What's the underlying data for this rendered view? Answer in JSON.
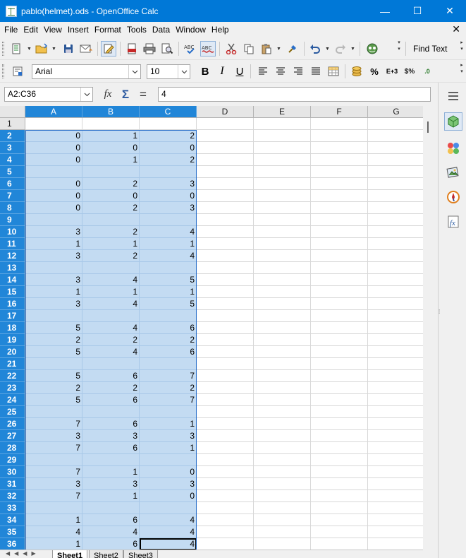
{
  "window": {
    "title": "pablo(helmet).ods - OpenOffice Calc",
    "minimize": "—",
    "maximize": "☐",
    "close": "✕"
  },
  "menu": [
    "File",
    "Edit",
    "View",
    "Insert",
    "Format",
    "Tools",
    "Data",
    "Window",
    "Help"
  ],
  "menu_close_doc": "✕",
  "toolbar": {
    "find_text": "Find Text"
  },
  "format_toolbar": {
    "font_name": "Arial",
    "font_size": "10",
    "bold": "B",
    "italic": "I",
    "underline": "U",
    "percent": "%",
    "scientific": "E+3",
    "currency": "$%",
    "add_decimal": ".0",
    "fx": "fx",
    "sum": "Σ",
    "equals": "="
  },
  "formula_bar": {
    "name_box": "A2:C36",
    "content": "4"
  },
  "columns": [
    "A",
    "B",
    "C",
    "D",
    "E",
    "F",
    "G"
  ],
  "selected_columns": [
    "A",
    "B",
    "C"
  ],
  "rows": [
    {
      "n": "1",
      "a": "",
      "b": "",
      "c": ""
    },
    {
      "n": "2",
      "a": "0",
      "b": "1",
      "c": "2"
    },
    {
      "n": "3",
      "a": "0",
      "b": "0",
      "c": "0"
    },
    {
      "n": "4",
      "a": "0",
      "b": "1",
      "c": "2"
    },
    {
      "n": "5",
      "a": "",
      "b": "",
      "c": ""
    },
    {
      "n": "6",
      "a": "0",
      "b": "2",
      "c": "3"
    },
    {
      "n": "7",
      "a": "0",
      "b": "0",
      "c": "0"
    },
    {
      "n": "8",
      "a": "0",
      "b": "2",
      "c": "3"
    },
    {
      "n": "9",
      "a": "",
      "b": "",
      "c": ""
    },
    {
      "n": "10",
      "a": "3",
      "b": "2",
      "c": "4"
    },
    {
      "n": "11",
      "a": "1",
      "b": "1",
      "c": "1"
    },
    {
      "n": "12",
      "a": "3",
      "b": "2",
      "c": "4"
    },
    {
      "n": "13",
      "a": "",
      "b": "",
      "c": ""
    },
    {
      "n": "14",
      "a": "3",
      "b": "4",
      "c": "5"
    },
    {
      "n": "15",
      "a": "1",
      "b": "1",
      "c": "1"
    },
    {
      "n": "16",
      "a": "3",
      "b": "4",
      "c": "5"
    },
    {
      "n": "17",
      "a": "",
      "b": "",
      "c": ""
    },
    {
      "n": "18",
      "a": "5",
      "b": "4",
      "c": "6"
    },
    {
      "n": "19",
      "a": "2",
      "b": "2",
      "c": "2"
    },
    {
      "n": "20",
      "a": "5",
      "b": "4",
      "c": "6"
    },
    {
      "n": "21",
      "a": "",
      "b": "",
      "c": ""
    },
    {
      "n": "22",
      "a": "5",
      "b": "6",
      "c": "7"
    },
    {
      "n": "23",
      "a": "2",
      "b": "2",
      "c": "2"
    },
    {
      "n": "24",
      "a": "5",
      "b": "6",
      "c": "7"
    },
    {
      "n": "25",
      "a": "",
      "b": "",
      "c": ""
    },
    {
      "n": "26",
      "a": "7",
      "b": "6",
      "c": "1"
    },
    {
      "n": "27",
      "a": "3",
      "b": "3",
      "c": "3"
    },
    {
      "n": "28",
      "a": "7",
      "b": "6",
      "c": "1"
    },
    {
      "n": "29",
      "a": "",
      "b": "",
      "c": ""
    },
    {
      "n": "30",
      "a": "7",
      "b": "1",
      "c": "0"
    },
    {
      "n": "31",
      "a": "3",
      "b": "3",
      "c": "3"
    },
    {
      "n": "32",
      "a": "7",
      "b": "1",
      "c": "0"
    },
    {
      "n": "33",
      "a": "",
      "b": "",
      "c": ""
    },
    {
      "n": "34",
      "a": "1",
      "b": "6",
      "c": "4"
    },
    {
      "n": "35",
      "a": "4",
      "b": "4",
      "c": "4"
    },
    {
      "n": "36",
      "a": "1",
      "b": "6",
      "c": "4"
    }
  ],
  "sheets": [
    "Sheet1",
    "Sheet2",
    "Sheet3"
  ],
  "active_sheet": "Sheet1",
  "colors": {
    "titlebar": "#0078d7",
    "selection": "#c3dbf2",
    "header_selected": "#2186d8"
  }
}
